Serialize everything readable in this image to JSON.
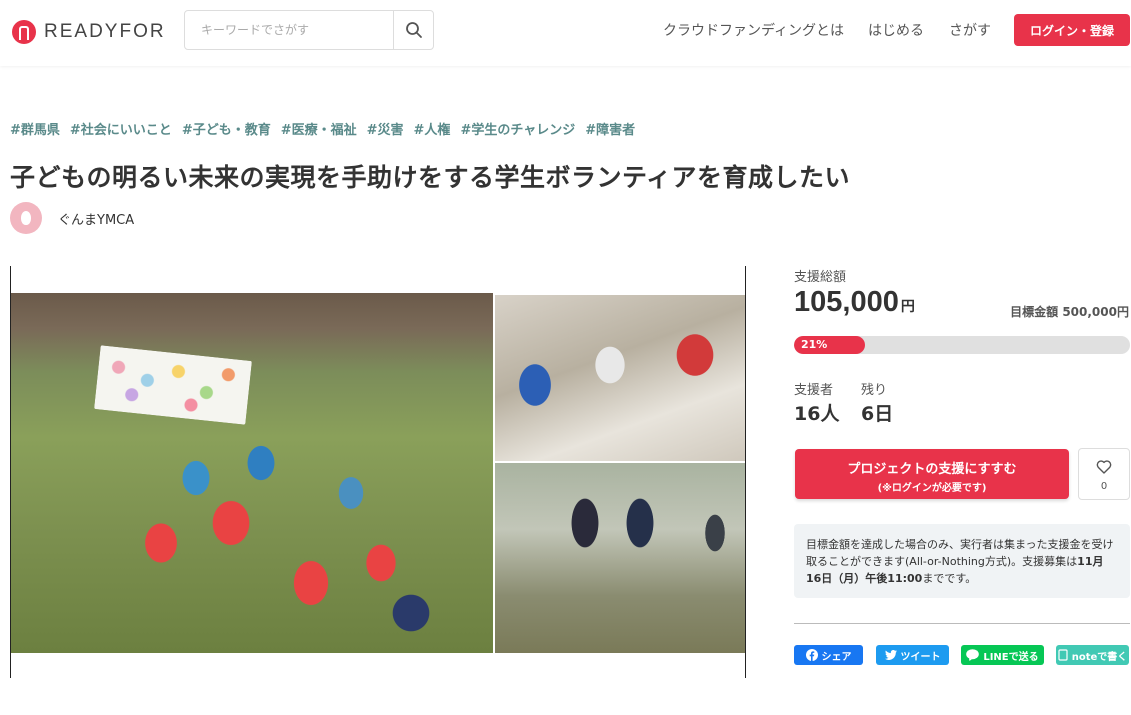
{
  "header": {
    "logo_text": "READYFOR",
    "search_placeholder": "キーワードでさがす",
    "nav": [
      "クラウドファンディングとは",
      "はじめる",
      "さがす"
    ],
    "login_label": "ログイン・登録"
  },
  "project": {
    "tags": [
      "#群馬県",
      "#社会にいいこと",
      "#子ども・教育",
      "#医療・福祉",
      "#災害",
      "#人権",
      "#学生のチャレンジ",
      "#障害者"
    ],
    "title": "子どもの明るい未来の実現を手助けをする学生ボランティアを育成したい",
    "owner": "ぐんまYMCA"
  },
  "funding": {
    "total_label": "支援総額",
    "total_value": "105,000",
    "total_unit": "円",
    "target_label": "目標金額",
    "target_value": "500,000円",
    "progress_label": "21%",
    "progress_fraction": 0.21,
    "supporters_label": "支援者",
    "supporters_value": "16人",
    "remaining_label": "残り",
    "remaining_value": "6日"
  },
  "actions": {
    "support_label": "プロジェクトの支援にすすむ",
    "support_sub": "(※ログインが必要です)",
    "favorite_count": "0"
  },
  "notice": {
    "text_1": "目標金額を達成した場合のみ、実行者は集まった支援金を受け取ることができます(All-or-Nothing方式)。支援募集は",
    "deadline": "11月16日（月）午後11:00",
    "text_2": "までです。"
  },
  "share": {
    "facebook": "シェア",
    "twitter": "ツイート",
    "line": "LINEで送る",
    "note": "noteで書く"
  },
  "colors": {
    "brand": "#e8334a",
    "tag": "#5a8a8a",
    "facebook": "#1877f2",
    "twitter": "#1d9bf0",
    "line": "#06c755",
    "note": "#41c9b4"
  }
}
